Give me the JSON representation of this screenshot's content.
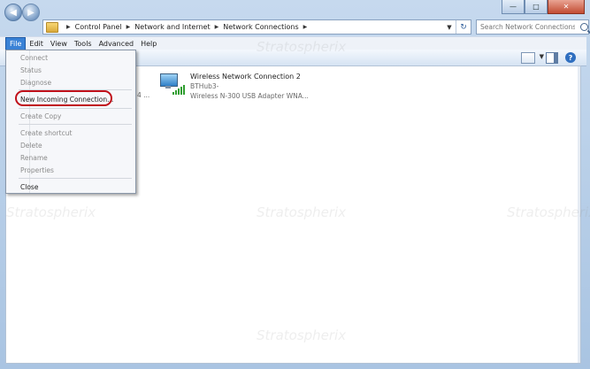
{
  "address_bar": {
    "breadcrumbs": [
      "Control Panel",
      "Network and Internet",
      "Network Connections"
    ]
  },
  "search": {
    "placeholder": "Search Network Connections"
  },
  "menubar": {
    "items": [
      "File",
      "Edit",
      "View",
      "Tools",
      "Advanced",
      "Help"
    ]
  },
  "connection": {
    "name": "Wireless Network Connection 2",
    "network": "BTHub3-",
    "adapter": "Wireless N-300 USB Adapter WNA...",
    "partial_left": "4 ..."
  },
  "file_menu": {
    "items": [
      "Connect",
      "Status",
      "Diagnose",
      "New Incoming Connection...",
      "Create Copy",
      "Create shortcut",
      "Delete",
      "Rename",
      "Properties",
      "Close"
    ]
  },
  "watermark": "Stratospherix",
  "colors": {
    "highlight_ring": "#c0101a",
    "menu_active": "#3a82d6"
  }
}
